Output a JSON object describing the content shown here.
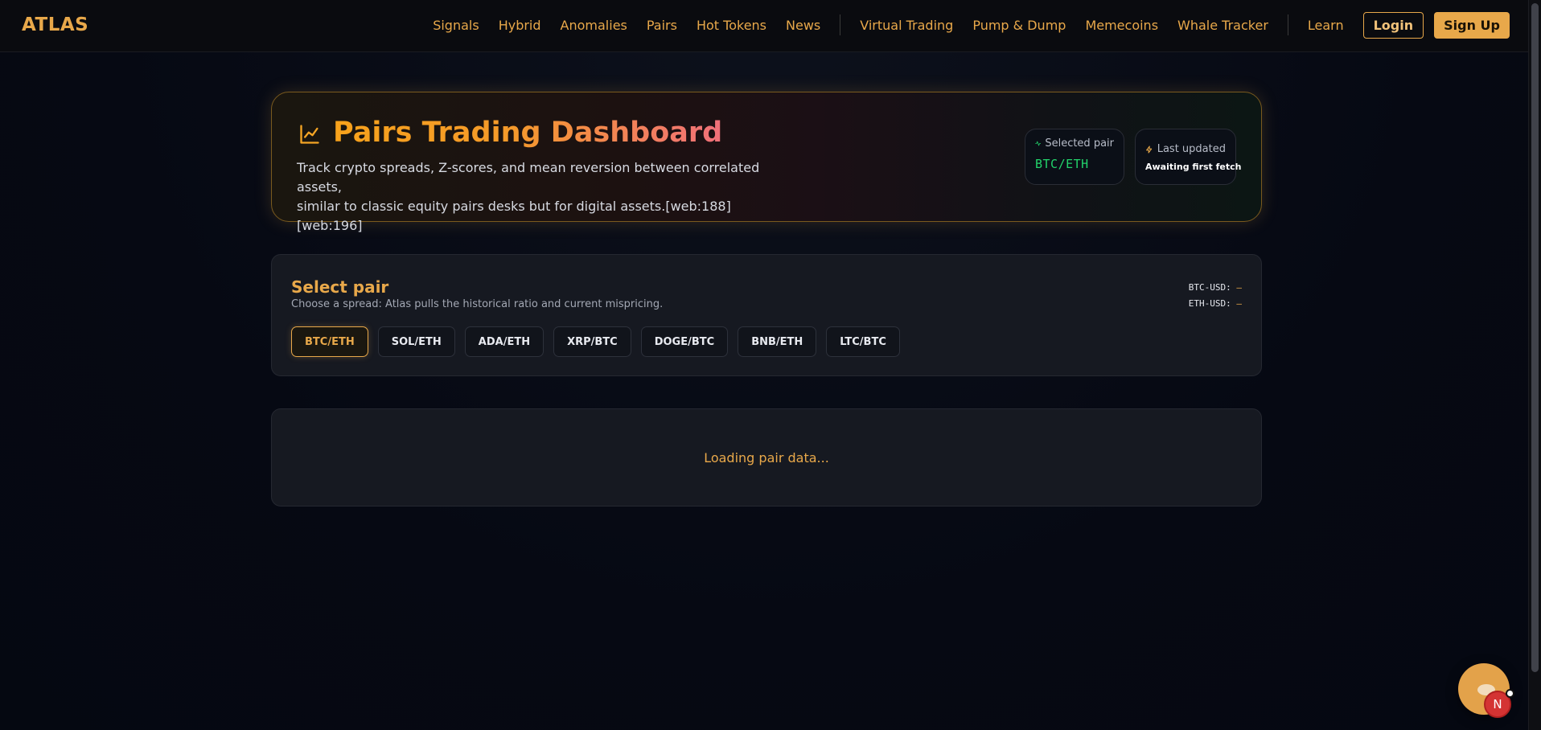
{
  "nav": {
    "brand": "ATLAS",
    "links_group1": [
      "Signals",
      "Hybrid",
      "Anomalies",
      "Pairs",
      "Hot Tokens",
      "News"
    ],
    "links_group2": [
      "Virtual Trading",
      "Pump & Dump",
      "Memecoins",
      "Whale Tracker"
    ],
    "learn": "Learn",
    "login": "Login",
    "signup": "Sign Up"
  },
  "hero": {
    "title": "Pairs Trading Dashboard",
    "subtitle_line1": "Track crypto spreads, Z-scores, and mean reversion between correlated assets,",
    "subtitle_line2": "similar to classic equity pairs desks but for digital assets.[web:188][web:196]",
    "selected_pair_label": "Selected pair",
    "selected_pair_value": "BTC/ETH",
    "last_updated_label": "Last updated",
    "last_updated_value": "Awaiting first fetch",
    "icon": "line-chart-icon"
  },
  "select": {
    "title": "Select pair",
    "subtitle": "Choose a spread: Atlas pulls the historical ratio and current mispricing.",
    "prices": [
      {
        "label": "BTC-USD:",
        "value": "—"
      },
      {
        "label": "ETH-USD:",
        "value": "—"
      }
    ],
    "pairs": [
      "BTC/ETH",
      "SOL/ETH",
      "ADA/ETH",
      "XRP/BTC",
      "DOGE/BTC",
      "BNB/ETH",
      "LTC/BTC"
    ],
    "active_pair": "BTC/ETH"
  },
  "loading": {
    "text": "Loading pair data..."
  },
  "avatar": {
    "initial": "N"
  },
  "colors": {
    "accent": "#e8a84a",
    "green": "#22d36b",
    "avatar": "#d43333"
  }
}
